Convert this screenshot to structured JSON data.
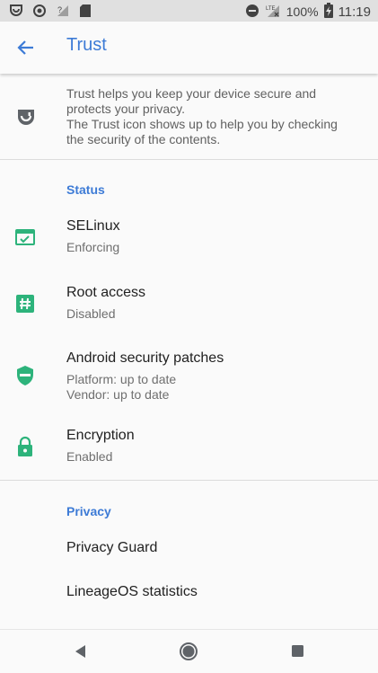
{
  "status_bar": {
    "battery_percent": "100%",
    "time": "11:19",
    "icons_left": [
      "trust-icon",
      "record-icon",
      "no-signal-icon",
      "sd-card-icon"
    ],
    "icons_right": [
      "do-not-disturb-icon",
      "lte-signal-icon",
      "battery-charging-icon"
    ]
  },
  "app_bar": {
    "title": "Trust"
  },
  "intro": {
    "text_line1": "Trust helps you keep your device secure and protects your privacy.",
    "text_line2": "The Trust icon shows up to help you by checking the security of the contents."
  },
  "status_section": {
    "header": "Status",
    "items": [
      {
        "title": "SELinux",
        "summary": "Enforcing",
        "icon": "selinux-icon"
      },
      {
        "title": "Root access",
        "summary": "Disabled",
        "icon": "hash-icon"
      },
      {
        "title": "Android security patches",
        "summary_line1": "Platform: up to date",
        "summary_line2": "Vendor: up to date",
        "icon": "shield-icon"
      },
      {
        "title": "Encryption",
        "summary": "Enabled",
        "icon": "lock-icon"
      }
    ],
    "icon_color": "#2db37b"
  },
  "privacy_section": {
    "header": "Privacy",
    "items": [
      {
        "title": "Privacy Guard"
      },
      {
        "title": "LineageOS statistics"
      }
    ]
  },
  "colors": {
    "accent": "#3d7bd6",
    "status_green": "#2db37b"
  }
}
